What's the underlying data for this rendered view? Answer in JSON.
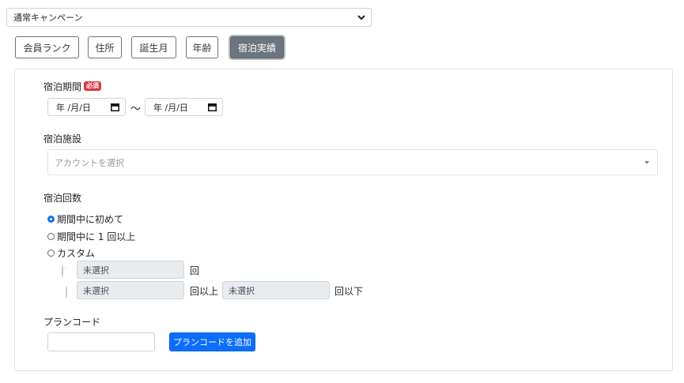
{
  "campaign_select": {
    "value": "通常キャンペーン"
  },
  "tabs": [
    {
      "label": "会員ランク",
      "active": false
    },
    {
      "label": "住所",
      "active": false
    },
    {
      "label": "誕生月",
      "active": false
    },
    {
      "label": "年齢",
      "active": false
    },
    {
      "label": "宿泊実績",
      "active": true
    }
  ],
  "stay_period": {
    "label": "宿泊期間",
    "required_badge": "必須",
    "from_placeholder": "年 /月/日",
    "separator": "〜",
    "to_placeholder": "年 /月/日"
  },
  "facility": {
    "label": "宿泊施設",
    "placeholder": "アカウントを選択"
  },
  "stay_count": {
    "label": "宿泊回数",
    "options": [
      {
        "label": "期間中に初めて",
        "checked": true
      },
      {
        "label": "期間中に 1 回以上",
        "checked": false
      },
      {
        "label": "カスタム",
        "checked": false
      }
    ],
    "custom_exact": {
      "value": "未選択",
      "suffix": "回"
    },
    "custom_range": {
      "min_value": "未選択",
      "min_suffix": "回以上",
      "max_value": "未選択",
      "max_suffix": "回以下"
    }
  },
  "plan_code": {
    "label": "プランコード",
    "value": "",
    "add_button": "プランコードを追加"
  },
  "colors": {
    "primary": "#0d6efd",
    "required": "#dc3545",
    "tab_active": "#6c757d"
  }
}
